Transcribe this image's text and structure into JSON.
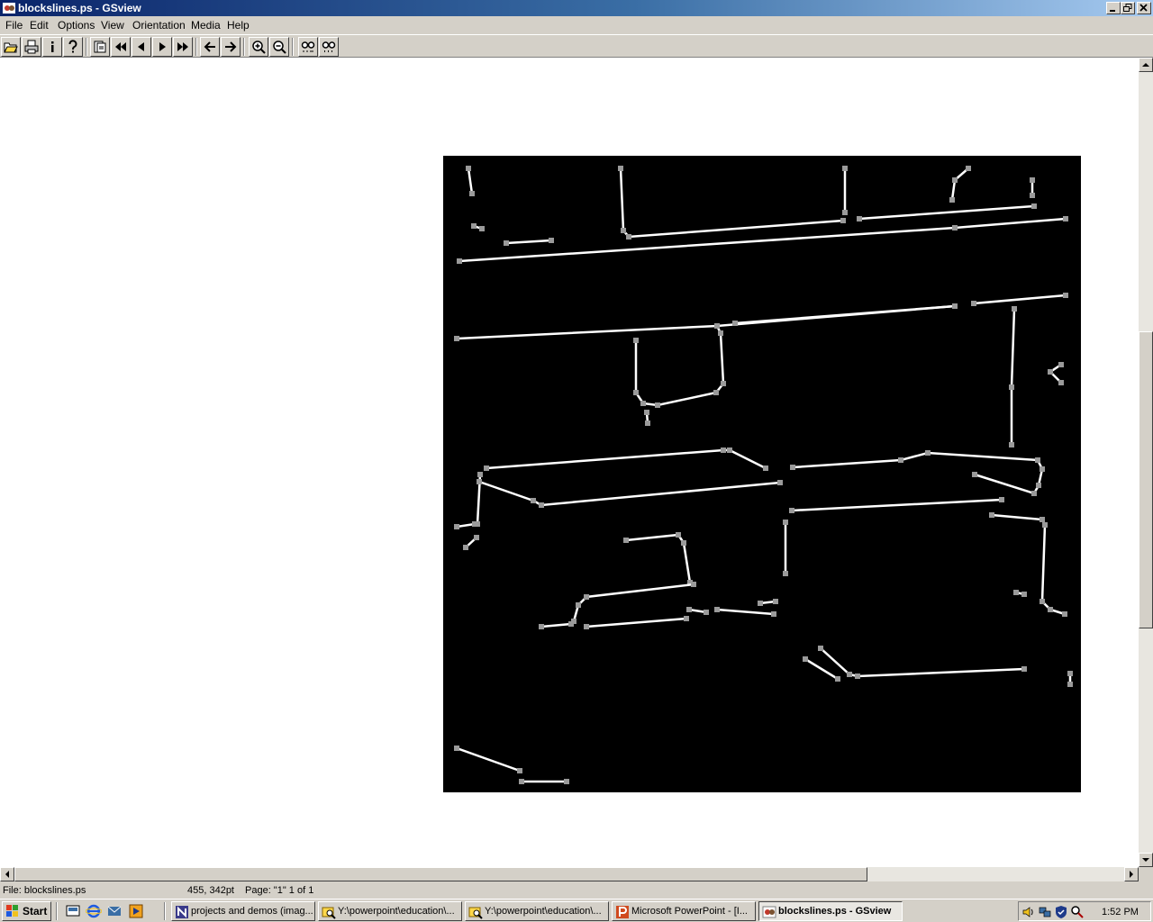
{
  "window": {
    "title": "blockslines.ps - GSview",
    "controls": [
      "minimize",
      "restore",
      "close"
    ]
  },
  "menu": [
    "File",
    "Edit",
    "Options",
    "View",
    "Orientation",
    "Media",
    "Help"
  ],
  "toolbar": {
    "buttons": [
      "open-icon",
      "print-icon",
      "info-icon",
      "help-icon",
      "goto-page-icon",
      "first-page-icon",
      "previous-page-icon",
      "next-page-icon",
      "last-page-icon",
      "back-icon",
      "forward-icon",
      "zoom-in-icon",
      "zoom-out-icon",
      "find-text-icon",
      "find-next-icon"
    ]
  },
  "document": {
    "background": "#000000",
    "line_color": "#ffffff",
    "node_color": "#9a9a9a"
  },
  "status": {
    "file": "File: blockslines.ps",
    "coords": "455, 342pt",
    "page": "Page: \"1\"  1 of 1"
  },
  "taskbar": {
    "start": "Start",
    "tasks": [
      {
        "label": "projects and demos (imag...",
        "icon": "onenote-icon",
        "active": false
      },
      {
        "label": "Y:\\powerpoint\\education\\...",
        "icon": "explorer-search-icon",
        "active": false
      },
      {
        "label": "Y:\\powerpoint\\education\\...",
        "icon": "explorer-search-icon",
        "active": false
      },
      {
        "label": "Microsoft PowerPoint - [I...",
        "icon": "powerpoint-icon",
        "active": false
      },
      {
        "label": "blockslines.ps - GSview",
        "icon": "gsview-icon",
        "active": true
      }
    ],
    "clock": "1:52 PM"
  }
}
